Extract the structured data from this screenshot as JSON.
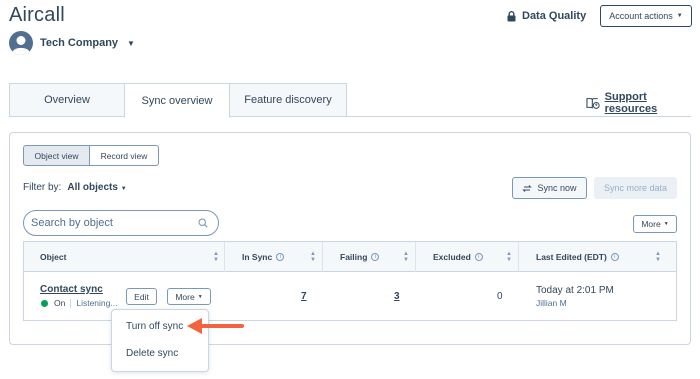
{
  "header": {
    "app_title": "Aircall",
    "company_name": "Tech Company",
    "data_quality_label": "Data Quality",
    "account_actions_label": "Account actions"
  },
  "tabs": [
    {
      "label": "Overview",
      "active": false
    },
    {
      "label": "Sync overview",
      "active": true
    },
    {
      "label": "Feature discovery",
      "active": false
    }
  ],
  "support_label": "Support resources",
  "view_toggle": {
    "object_view": "Object view",
    "record_view": "Record view"
  },
  "filter": {
    "label": "Filter by:",
    "value": "All objects"
  },
  "buttons": {
    "sync_now": "Sync now",
    "sync_more": "Sync more data",
    "more": "More"
  },
  "search": {
    "placeholder": "Search by object",
    "value": ""
  },
  "table": {
    "columns": [
      "Object",
      "In Sync",
      "Failing",
      "Excluded",
      "Last Edited (EDT)"
    ],
    "rows": [
      {
        "name": "Contact sync",
        "status": "On",
        "status_detail": "Listening...",
        "edit_label": "Edit",
        "more_label": "More",
        "in_sync": "7",
        "failing": "3",
        "excluded": "0",
        "last_edited": "Today at 2:01 PM",
        "edited_by": "Jillian M"
      }
    ]
  },
  "dropdown": {
    "items": [
      "Turn off sync",
      "Delete sync"
    ]
  },
  "colors": {
    "text": "#33475b",
    "status_on": "#00a15c",
    "callout_arrow": "#f2633f",
    "border": "#cbd6e2"
  }
}
